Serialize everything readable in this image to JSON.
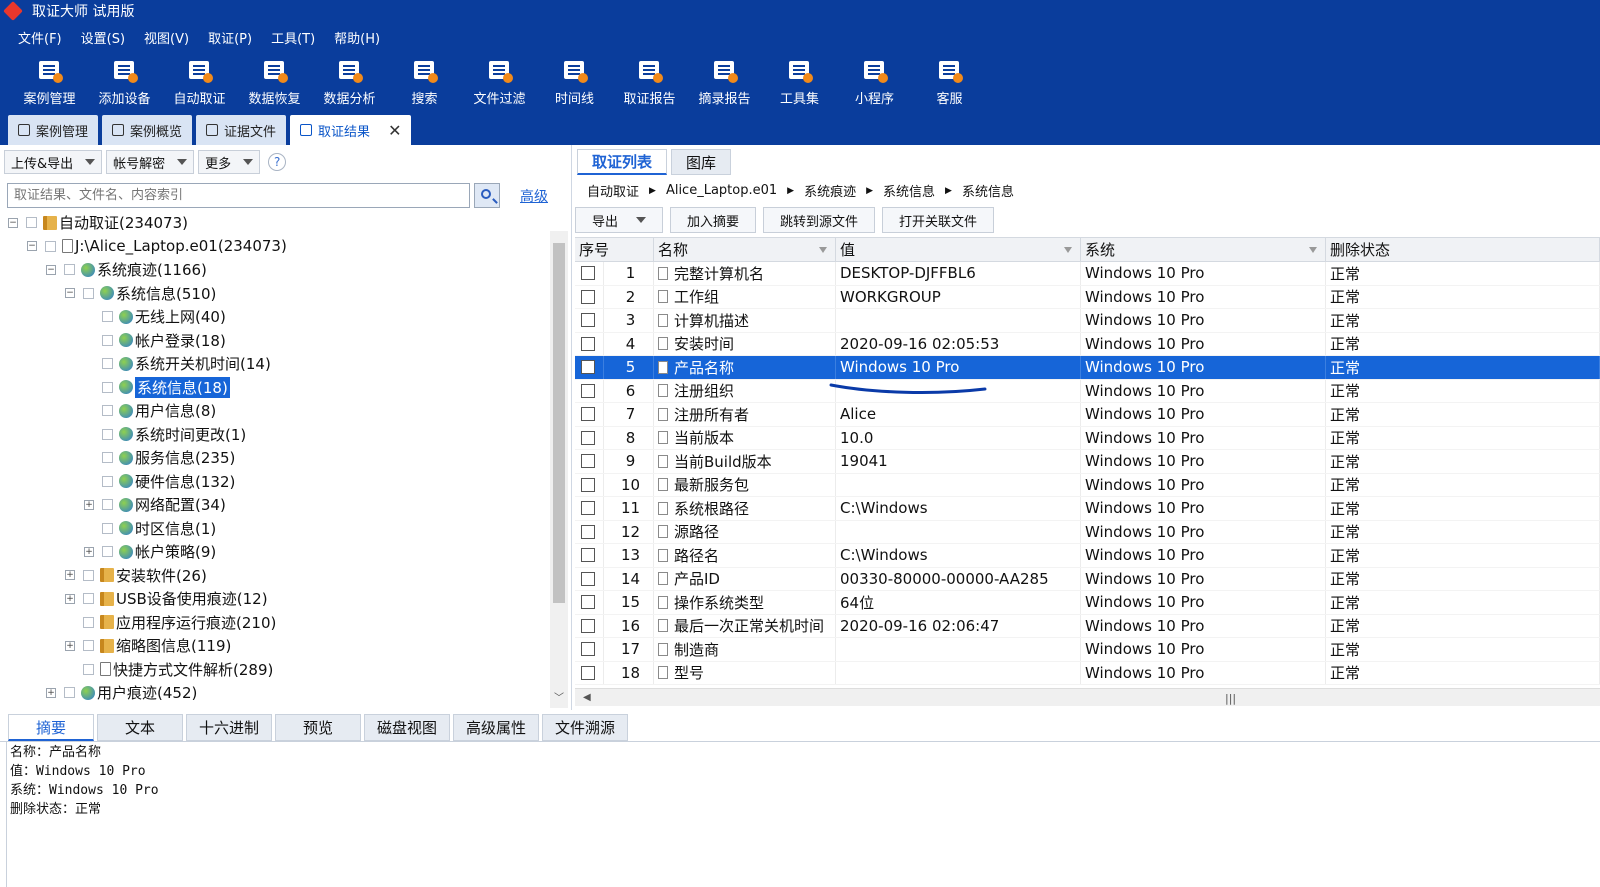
{
  "app": {
    "title": "取证大师 试用版"
  },
  "menu": [
    "文件(F)",
    "设置(S)",
    "视图(V)",
    "取证(P)",
    "工具(T)",
    "帮助(H)"
  ],
  "toolbar": [
    "案例管理",
    "添加设备",
    "自动取证",
    "数据恢复",
    "数据分析",
    "搜索",
    "文件过滤",
    "时间线",
    "取证报告",
    "摘录报告",
    "工具集",
    "小程序",
    "客服"
  ],
  "doc_tabs": [
    {
      "label": "案例管理"
    },
    {
      "label": "案例概览"
    },
    {
      "label": "证据文件"
    },
    {
      "label": "取证结果",
      "active": true
    }
  ],
  "left": {
    "tools": [
      "上传&导出",
      "帐号解密",
      "更多"
    ],
    "help": "?",
    "search_placeholder": "取证结果、文件名、内容索引",
    "advanced": "高级",
    "tree": [
      {
        "label": "自动取证(234073)",
        "level": 0,
        "exp": "-",
        "icon": "bar"
      },
      {
        "label": "J:\\Alice_Laptop.e01(234073)",
        "level": 1,
        "exp": "-",
        "icon": "file"
      },
      {
        "label": "系统痕迹(1166)",
        "level": 2,
        "exp": "-",
        "icon": "globe"
      },
      {
        "label": "系统信息(510)",
        "level": 3,
        "exp": "-",
        "icon": "globe"
      },
      {
        "label": "无线上网(40)",
        "level": 4,
        "exp": "",
        "icon": "globe"
      },
      {
        "label": "帐户登录(18)",
        "level": 4,
        "exp": "",
        "icon": "globe"
      },
      {
        "label": "系统开关机时间(14)",
        "level": 4,
        "exp": "",
        "icon": "globe"
      },
      {
        "label": "系统信息(18)",
        "level": 4,
        "exp": "",
        "icon": "globe",
        "selected": true
      },
      {
        "label": "用户信息(8)",
        "level": 4,
        "exp": "",
        "icon": "globe"
      },
      {
        "label": "系统时间更改(1)",
        "level": 4,
        "exp": "",
        "icon": "globe"
      },
      {
        "label": "服务信息(235)",
        "level": 4,
        "exp": "",
        "icon": "globe"
      },
      {
        "label": "硬件信息(132)",
        "level": 4,
        "exp": "",
        "icon": "globe"
      },
      {
        "label": "网络配置(34)",
        "level": 4,
        "exp": "+",
        "icon": "globe"
      },
      {
        "label": "时区信息(1)",
        "level": 4,
        "exp": "",
        "icon": "globe"
      },
      {
        "label": "帐户策略(9)",
        "level": 4,
        "exp": "+",
        "icon": "globe"
      },
      {
        "label": "安装软件(26)",
        "level": 3,
        "exp": "+",
        "icon": "bar"
      },
      {
        "label": "USB设备使用痕迹(12)",
        "level": 3,
        "exp": "+",
        "icon": "bar"
      },
      {
        "label": "应用程序运行痕迹(210)",
        "level": 3,
        "exp": "",
        "icon": "bar"
      },
      {
        "label": "缩略图信息(119)",
        "level": 3,
        "exp": "+",
        "icon": "bar"
      },
      {
        "label": "快捷方式文件解析(289)",
        "level": 3,
        "exp": "",
        "icon": "file"
      },
      {
        "label": "用户痕迹(452)",
        "level": 2,
        "exp": "+",
        "icon": "globe"
      }
    ]
  },
  "right": {
    "tabs": [
      "取证列表",
      "图库"
    ],
    "breadcrumb": [
      "自动取证",
      "Alice_Laptop.e01",
      "系统痕迹",
      "系统信息",
      "系统信息"
    ],
    "actions": [
      "导出",
      "加入摘要",
      "跳转到源文件",
      "打开关联文件"
    ],
    "columns": [
      "序号",
      "名称",
      "值",
      "系统",
      "删除状态"
    ],
    "rows": [
      {
        "no": "1",
        "name": "完整计算机名",
        "value": "DESKTOP-DJFFBL6",
        "system": "Windows 10 Pro",
        "status": "正常"
      },
      {
        "no": "2",
        "name": "工作组",
        "value": "WORKGROUP",
        "system": "Windows 10 Pro",
        "status": "正常"
      },
      {
        "no": "3",
        "name": "计算机描述",
        "value": "",
        "system": "Windows 10 Pro",
        "status": "正常"
      },
      {
        "no": "4",
        "name": "安装时间",
        "value": "2020-09-16 02:05:53",
        "system": "Windows 10 Pro",
        "status": "正常"
      },
      {
        "no": "5",
        "name": "产品名称",
        "value": "Windows 10 Pro",
        "system": "Windows 10 Pro",
        "status": "正常",
        "selected": true
      },
      {
        "no": "6",
        "name": "注册组织",
        "value": "",
        "system": "Windows 10 Pro",
        "status": "正常"
      },
      {
        "no": "7",
        "name": "注册所有者",
        "value": "Alice",
        "system": "Windows 10 Pro",
        "status": "正常"
      },
      {
        "no": "8",
        "name": "当前版本",
        "value": "10.0",
        "system": "Windows 10 Pro",
        "status": "正常"
      },
      {
        "no": "9",
        "name": "当前Build版本",
        "value": "19041",
        "system": "Windows 10 Pro",
        "status": "正常"
      },
      {
        "no": "10",
        "name": "最新服务包",
        "value": "",
        "system": "Windows 10 Pro",
        "status": "正常"
      },
      {
        "no": "11",
        "name": "系统根路径",
        "value": "C:\\Windows",
        "system": "Windows 10 Pro",
        "status": "正常"
      },
      {
        "no": "12",
        "name": "源路径",
        "value": "",
        "system": "Windows 10 Pro",
        "status": "正常"
      },
      {
        "no": "13",
        "name": "路径名",
        "value": "C:\\Windows",
        "system": "Windows 10 Pro",
        "status": "正常"
      },
      {
        "no": "14",
        "name": "产品ID",
        "value": "00330-80000-00000-AA285",
        "system": "Windows 10 Pro",
        "status": "正常"
      },
      {
        "no": "15",
        "name": "操作系统类型",
        "value": "64位",
        "system": "Windows 10 Pro",
        "status": "正常"
      },
      {
        "no": "16",
        "name": "最后一次正常关机时间",
        "value": "2020-09-16 02:06:47",
        "system": "Windows 10 Pro",
        "status": "正常"
      },
      {
        "no": "17",
        "name": "制造商",
        "value": "",
        "system": "Windows 10 Pro",
        "status": "正常"
      },
      {
        "no": "18",
        "name": "型号",
        "value": "",
        "system": "Windows 10 Pro",
        "status": "正常"
      }
    ]
  },
  "bottom": {
    "tabs": [
      "摘要",
      "文本",
      "十六进制",
      "预览",
      "磁盘视图",
      "高级属性",
      "文件溯源"
    ],
    "summary": [
      "名称：产品名称",
      "值：Windows 10 Pro",
      "系统：Windows 10 Pro",
      "删除状态：正常"
    ]
  },
  "colors": {
    "chrome": "#0a3d9c",
    "selection": "#1665d8",
    "annotation_line": "#0a3aa8"
  }
}
